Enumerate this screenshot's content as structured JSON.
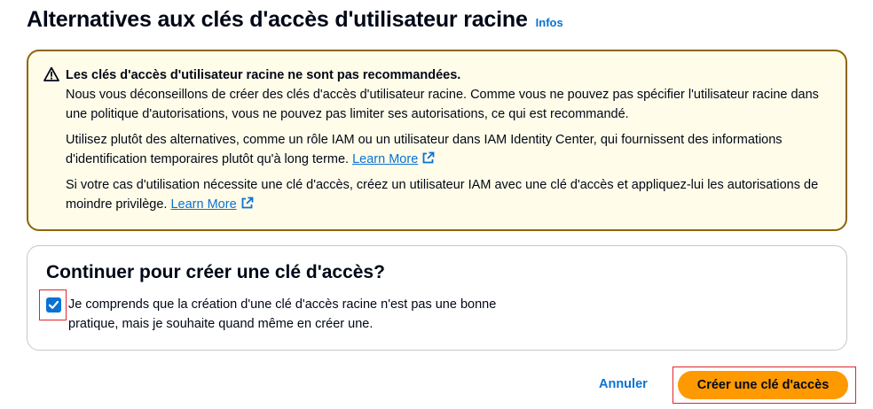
{
  "header": {
    "title": "Alternatives aux clés d'accès d'utilisateur racine",
    "info_link": "Infos"
  },
  "warning": {
    "icon": "warning-triangle-icon",
    "heading": "Les clés d'accès d'utilisateur racine ne sont pas recommandées.",
    "paragraph1": "Nous vous déconseillons de créer des clés d'accès d'utilisateur racine. Comme vous ne pouvez pas spécifier l'utilisateur racine dans une politique d'autorisations, vous ne pouvez pas limiter ses autorisations, ce qui est recommandé.",
    "paragraph2_text": "Utilisez plutôt des alternatives, comme un rôle IAM ou un utilisateur dans IAM Identity Center, qui fournissent des informations d'identification temporaires plutôt qu'à long terme.",
    "paragraph2_link": "Learn More",
    "paragraph3_text": "Si votre cas d'utilisation nécessite une clé d'accès, créez un utilisateur IAM avec une clé d'accès et appliquez-lui les autorisations de moindre privilège.",
    "paragraph3_link": "Learn More",
    "link_icon": "external-link-icon"
  },
  "confirm": {
    "title": "Continuer pour créer une clé d'accès?",
    "checkbox_checked": true,
    "checkbox_label": "Je comprends que la création d'une clé d'accès racine n'est pas une bonne pratique, mais je souhaite quand même en créer une."
  },
  "actions": {
    "cancel_label": "Annuler",
    "create_label": "Créer une clé d'accès"
  },
  "colors": {
    "accent": "#0972d3",
    "warning_border": "#8d6605",
    "warning_bg": "#fffce9",
    "primary_button": "#ff9900",
    "highlight": "#e0262c"
  }
}
